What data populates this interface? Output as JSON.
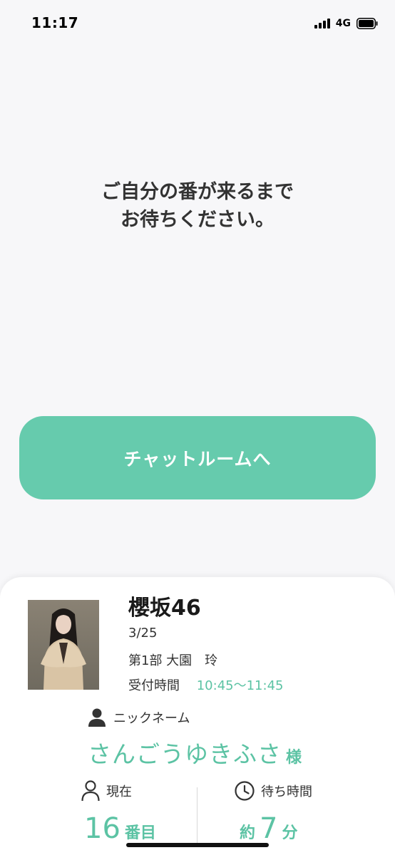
{
  "status_bar": {
    "time": "11:17",
    "network": "4G"
  },
  "main": {
    "message_line1": "ご自分の番が来るまで",
    "message_line2": "お待ちください。",
    "chat_button_label": "チャットルームへ"
  },
  "ticket": {
    "group_name": "櫻坂46",
    "date": "3/25",
    "session": "第1部 大園　玲",
    "reception_label": "受付時間",
    "reception_time": "10:45〜11:45",
    "nickname_label": "ニックネーム",
    "nickname": "さんごうゆきふさ",
    "nickname_suffix": "様",
    "current_label": "現在",
    "current_number": "16",
    "current_unit": "番目",
    "wait_label": "待ち時間",
    "wait_prefix": "約",
    "wait_number": "7",
    "wait_unit": "分"
  },
  "colors": {
    "accent": "#66cbad",
    "accent_text": "#5cc3a4",
    "background": "#f7f7f9"
  },
  "icons": {
    "signal": "signal-icon",
    "battery": "battery-icon",
    "person": "person-icon",
    "person_outline": "person-outline-icon",
    "clock": "clock-icon"
  }
}
